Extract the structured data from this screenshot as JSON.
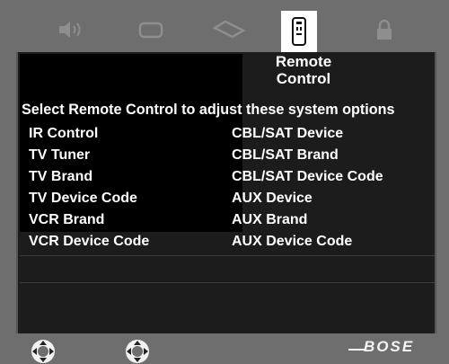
{
  "tabs": [
    {
      "icon": "speaker-icon"
    },
    {
      "icon": "display-icon"
    },
    {
      "icon": "disc-icon"
    },
    {
      "icon": "remote-icon",
      "active": true
    },
    {
      "icon": "lock-icon"
    }
  ],
  "panel": {
    "title_line1": "Remote",
    "title_line2": "Control",
    "instruction": "Select Remote Control to adjust these system options",
    "left_options": [
      "IR Control",
      "TV Tuner",
      "TV Brand",
      "TV Device Code",
      "VCR Brand",
      "VCR Device Code"
    ],
    "right_options": [
      "CBL/SAT Device",
      "CBL/SAT Brand",
      "CBL/SAT Device Code",
      "AUX Device",
      "AUX Brand",
      "AUX Device Code"
    ]
  },
  "footer": {
    "brand": "BOSE",
    "nav_icons": [
      "nav-pad-icon",
      "nav-pad-icon"
    ]
  }
}
